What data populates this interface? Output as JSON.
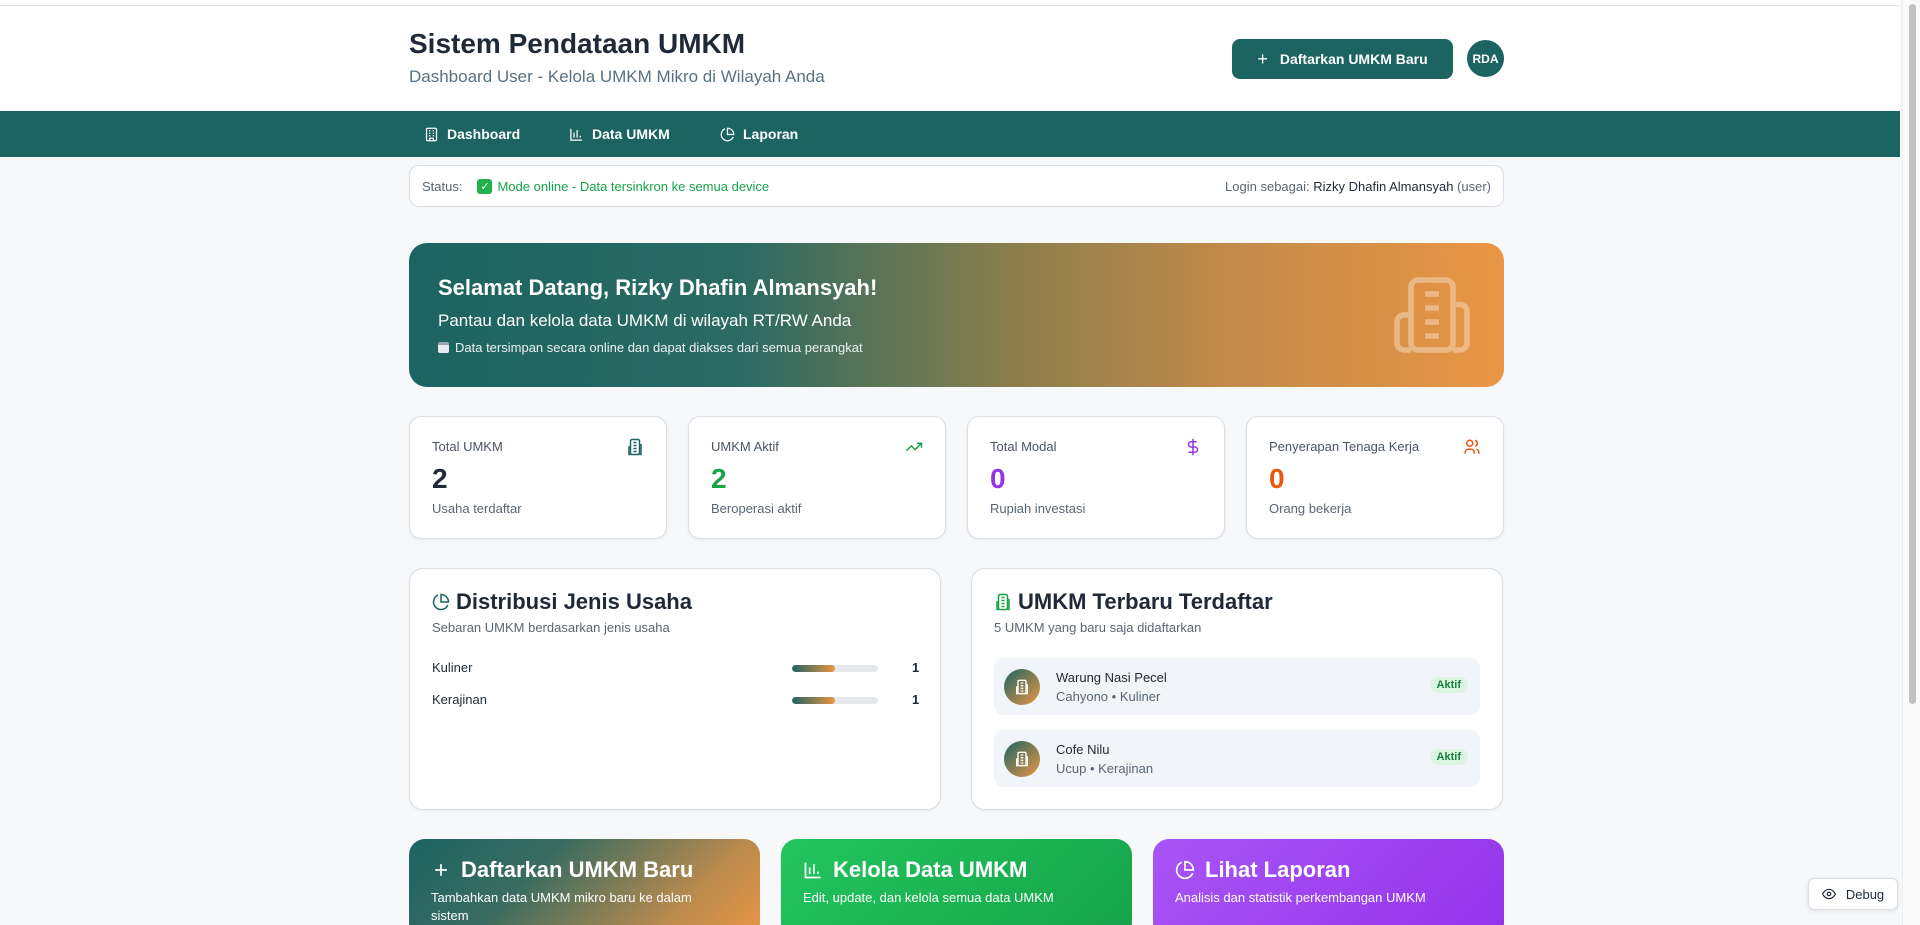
{
  "header": {
    "title": "Sistem Pendataan UMKM",
    "subtitle": "Dashboard User - Kelola UMKM Mikro di Wilayah Anda",
    "register_button": "Daftarkan UMKM Baru",
    "avatar_initials": "RDA"
  },
  "nav": {
    "items": [
      {
        "label": "Dashboard",
        "icon": "building-icon"
      },
      {
        "label": "Data UMKM",
        "icon": "bar-chart-icon"
      },
      {
        "label": "Laporan",
        "icon": "pie-chart-icon"
      }
    ]
  },
  "status": {
    "label": "Status:",
    "online_text": "Mode online - Data tersinkron ke semua device",
    "login_prefix": "Login sebagai:",
    "login_name": "Rizky Dhafin Almansyah",
    "login_role": "(user)"
  },
  "welcome": {
    "title": "Selamat Datang, Rizky Dhafin Almansyah!",
    "subtitle": "Pantau dan kelola data UMKM di wilayah RT/RW Anda",
    "note": "Data tersimpan secara online dan dapat diakses dari semua perangkat"
  },
  "stats": [
    {
      "label": "Total UMKM",
      "value": "2",
      "desc": "Usaha terdaftar",
      "color": "#1f2937",
      "icon": "building-icon"
    },
    {
      "label": "UMKM Aktif",
      "value": "2",
      "desc": "Beroperasi aktif",
      "color": "#16a34a",
      "icon": "trending-up-icon"
    },
    {
      "label": "Total Modal",
      "value": "0",
      "desc": "Rupiah investasi",
      "color": "#9333ea",
      "icon": "dollar-icon"
    },
    {
      "label": "Penyerapan Tenaga Kerja",
      "value": "0",
      "desc": "Orang bekerja",
      "color": "#ea580c",
      "icon": "users-icon"
    }
  ],
  "distribution": {
    "title": "Distribusi Jenis Usaha",
    "subtitle": "Sebaran UMKM berdasarkan jenis usaha",
    "rows": [
      {
        "label": "Kuliner",
        "count": "1",
        "fraction": 0.5
      },
      {
        "label": "Kerajinan",
        "count": "1",
        "fraction": 0.5
      }
    ]
  },
  "latest": {
    "title": "UMKM Terbaru Terdaftar",
    "subtitle": "5 UMKM yang baru saja didaftarkan",
    "items": [
      {
        "name": "Warung Nasi Pecel",
        "meta": "Cahyono • Kuliner",
        "badge": "Aktif"
      },
      {
        "name": "Cofe Nilu",
        "meta": "Ucup • Kerajinan",
        "badge": "Aktif"
      }
    ]
  },
  "actions": [
    {
      "title": "Daftarkan UMKM Baru",
      "desc": "Tambahkan data UMKM mikro baru ke dalam sistem",
      "icon": "plus-icon"
    },
    {
      "title": "Kelola Data UMKM",
      "desc": "Edit, update, dan kelola semua data UMKM",
      "icon": "bar-chart-icon"
    },
    {
      "title": "Lihat Laporan",
      "desc": "Analisis dan statistik perkembangan UMKM",
      "icon": "pie-chart-icon"
    }
  ],
  "debug": {
    "label": "Debug"
  }
}
